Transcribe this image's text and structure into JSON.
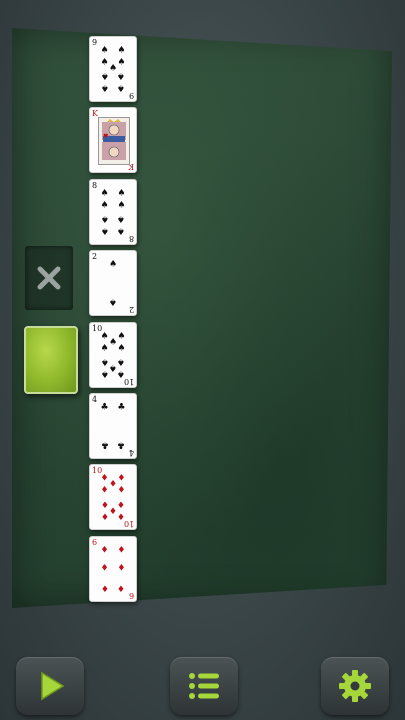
{
  "colors": {
    "felt": "#2a4634",
    "accent_green": "#9acd32",
    "button_bg": "#3b4244",
    "red_suit": "#c1121c",
    "black_suit": "#111111"
  },
  "game": {
    "discard_icon": "close-x-icon",
    "stock_card_back": "green-card-back",
    "column_cards": [
      {
        "rank": "9",
        "suit": "spades",
        "symbol": "♠",
        "color": "black"
      },
      {
        "rank": "K",
        "suit": "hearts",
        "symbol": "♥",
        "color": "red"
      },
      {
        "rank": "8",
        "suit": "spades",
        "symbol": "♠",
        "color": "black"
      },
      {
        "rank": "2",
        "suit": "spades",
        "symbol": "♠",
        "color": "black"
      },
      {
        "rank": "10",
        "suit": "spades",
        "symbol": "♠",
        "color": "black"
      },
      {
        "rank": "4",
        "suit": "clubs",
        "symbol": "♣",
        "color": "black"
      },
      {
        "rank": "10",
        "suit": "diamonds",
        "symbol": "♦",
        "color": "red"
      },
      {
        "rank": "6",
        "suit": "diamonds",
        "symbol": "♦",
        "color": "red"
      }
    ]
  },
  "toolbar": {
    "buttons": [
      {
        "name": "play-button",
        "icon": "play-icon"
      },
      {
        "name": "menu-button",
        "icon": "menu-list-icon"
      },
      {
        "name": "settings-button",
        "icon": "gear-icon"
      }
    ]
  }
}
